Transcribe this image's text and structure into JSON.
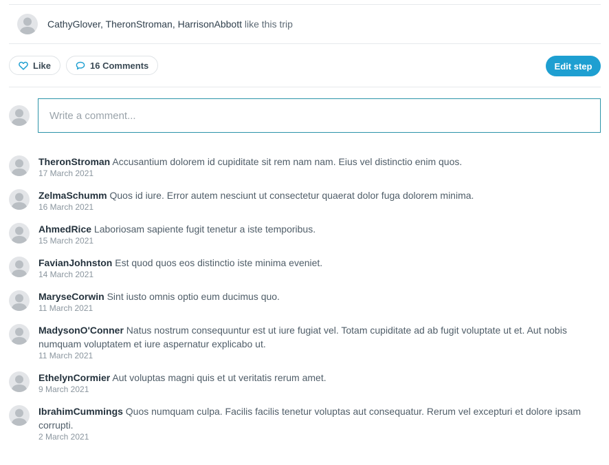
{
  "likes": {
    "names": "CathyGlover, TheronStroman, HarrisonAbbott",
    "suffix": " like this trip"
  },
  "actions": {
    "like_label": "Like",
    "comments_label": "16 Comments",
    "edit_label": "Edit step"
  },
  "comment_input": {
    "placeholder": "Write a comment..."
  },
  "colors": {
    "accent": "#1e9fd1",
    "input_border": "#2a93a8"
  },
  "comments": [
    {
      "author": "TheronStroman",
      "text": "Accusantium dolorem id cupiditate sit rem nam nam. Eius vel distinctio enim quos.",
      "date": "17 March 2021"
    },
    {
      "author": "ZelmaSchumm",
      "text": "Quos id iure. Error autem nesciunt ut consectetur quaerat dolor fuga dolorem minima.",
      "date": "16 March 2021"
    },
    {
      "author": "AhmedRice",
      "text": "Laboriosam sapiente fugit tenetur a iste temporibus.",
      "date": "15 March 2021"
    },
    {
      "author": "FavianJohnston",
      "text": "Est quod quos eos distinctio iste minima eveniet.",
      "date": "14 March 2021"
    },
    {
      "author": "MaryseCorwin",
      "text": "Sint iusto omnis optio eum ducimus quo.",
      "date": "11 March 2021"
    },
    {
      "author": "MadysonO'Conner",
      "text": "Natus nostrum consequuntur est ut iure fugiat vel. Totam cupiditate ad ab fugit voluptate ut et. Aut nobis numquam voluptatem et iure aspernatur explicabo ut.",
      "date": "11 March 2021"
    },
    {
      "author": "EthelynCormier",
      "text": "Aut voluptas magni quis et ut veritatis rerum amet.",
      "date": "9 March 2021"
    },
    {
      "author": "IbrahimCummings",
      "text": "Quos numquam culpa. Facilis facilis tenetur voluptas aut consequatur. Rerum vel excepturi et dolore ipsam corrupti.",
      "date": "2 March 2021"
    }
  ]
}
